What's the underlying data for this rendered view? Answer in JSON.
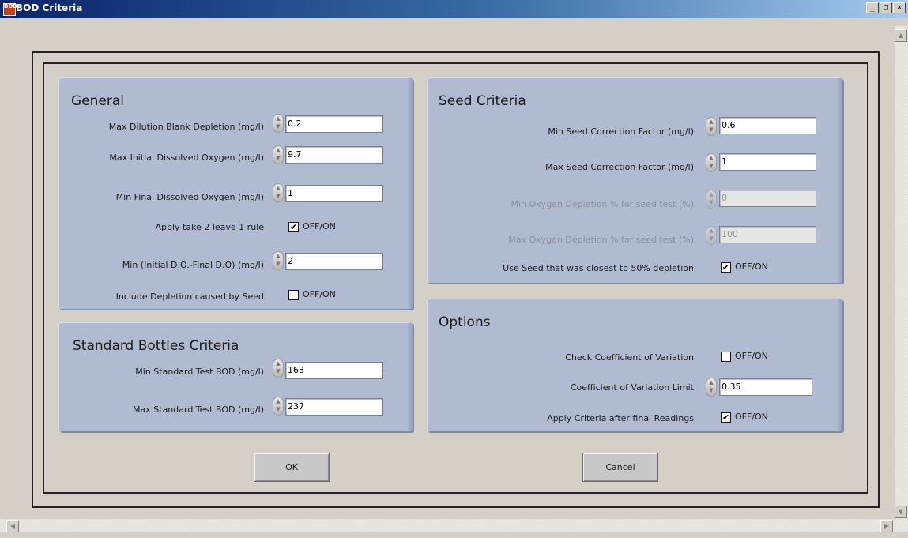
{
  "window": {
    "title": "BOD Criteria",
    "app_icon_text": "BOD",
    "controls": {
      "minimize": "_",
      "maximize": "□",
      "close": "×"
    }
  },
  "general": {
    "title": "General",
    "max_dilution_blank_depletion": {
      "label": "Max Dilution Blank Depletion (mg/l)",
      "value": "0.2"
    },
    "max_initial_do": {
      "label": "Max Initial Dissolved Oxygen (mg/l)",
      "value": "9.7"
    },
    "min_final_do": {
      "label": "Min Final Dissolved Oxygen (mg/l)",
      "value": "1"
    },
    "apply_take2leave1": {
      "label": "Apply take 2 leave 1 rule",
      "checked": true,
      "toggle_label": "OFF/ON"
    },
    "min_initial_minus_final": {
      "label": "Min (Initial D.O.-Final D.O) (mg/l)",
      "value": "2"
    },
    "include_seed_depletion": {
      "label": "Include Depletion caused by Seed",
      "checked": false,
      "toggle_label": "OFF/ON"
    }
  },
  "standard": {
    "title": "Standard Bottles Criteria",
    "min_std_bod": {
      "label": "Min Standard Test BOD (mg/l)",
      "value": "163"
    },
    "max_std_bod": {
      "label": "Max Standard Test BOD (mg/l)",
      "value": "237"
    }
  },
  "seed": {
    "title": "Seed Criteria",
    "min_correction": {
      "label": "Min Seed Correction Factor (mg/l)",
      "value": "0.6"
    },
    "max_correction": {
      "label": "Max Seed Correction Factor (mg/l)",
      "value": "1"
    },
    "min_o2_depletion": {
      "label": "Min Oxygen Depletion % for seed test (%)",
      "value": "0",
      "disabled": true
    },
    "max_o2_depletion": {
      "label": "Max Oxygen Depletion % for seed test (%)",
      "value": "100",
      "disabled": true
    },
    "closest_50": {
      "label": "Use Seed that was closest to 50% depletion",
      "checked": true,
      "toggle_label": "OFF/ON"
    }
  },
  "options": {
    "title": "Options",
    "check_cov": {
      "label": "Check Coefficient of Variation",
      "checked": false,
      "toggle_label": "OFF/ON"
    },
    "cov_limit": {
      "label": "Coefficient of Variation Limit",
      "value": "0.35"
    },
    "apply_after_final": {
      "label": "Apply Criteria after final Readings",
      "checked": true,
      "toggle_label": "OFF/ON"
    }
  },
  "buttons": {
    "ok": "OK",
    "cancel": "Cancel"
  },
  "checkmark": "✔",
  "spin_glyphs": {
    "up": "▲",
    "down": "▼"
  },
  "scroll_glyphs": {
    "up": "▲",
    "down": "▼",
    "left": "◀",
    "right": "▶"
  }
}
